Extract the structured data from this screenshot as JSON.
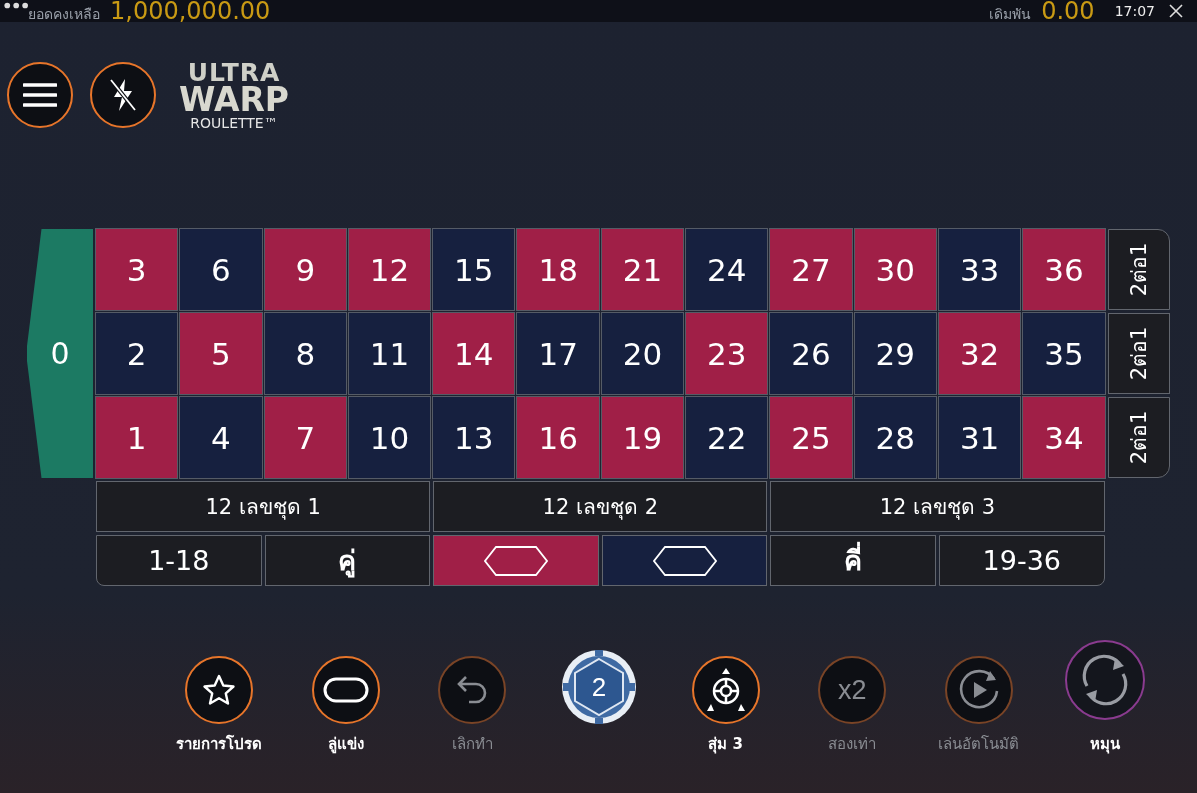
{
  "top_bar": {
    "balance_label": "ยอดคงเหลือ",
    "balance": "1,000,000.00",
    "bet_label": "เดิมพัน",
    "bet": "0.00",
    "time": "17:07"
  },
  "logo": {
    "line_1": "ULTRA",
    "line_2": "WARP",
    "line_3": "ROULETTE™"
  },
  "table": {
    "zero": "0",
    "rows": [
      {
        "cells": [
          {
            "number": "3",
            "color": "#a01f47"
          },
          {
            "number": "6",
            "color": "#16203f"
          },
          {
            "number": "9",
            "color": "#a01f47"
          },
          {
            "number": "12",
            "color": "#a01f47"
          },
          {
            "number": "15",
            "color": "#16203f"
          },
          {
            "number": "18",
            "color": "#a01f47"
          },
          {
            "number": "21",
            "color": "#a01f47"
          },
          {
            "number": "24",
            "color": "#16203f"
          },
          {
            "number": "27",
            "color": "#a01f47"
          },
          {
            "number": "30",
            "color": "#a01f47"
          },
          {
            "number": "33",
            "color": "#16203f"
          },
          {
            "number": "36",
            "color": "#a01f47"
          }
        ],
        "column_bet": "2ต่อ1"
      },
      {
        "cells": [
          {
            "number": "2",
            "color": "#16203f"
          },
          {
            "number": "5",
            "color": "#a01f47"
          },
          {
            "number": "8",
            "color": "#16203f"
          },
          {
            "number": "11",
            "color": "#16203f"
          },
          {
            "number": "14",
            "color": "#a01f47"
          },
          {
            "number": "17",
            "color": "#16203f"
          },
          {
            "number": "20",
            "color": "#16203f"
          },
          {
            "number": "23",
            "color": "#a01f47"
          },
          {
            "number": "26",
            "color": "#16203f"
          },
          {
            "number": "29",
            "color": "#16203f"
          },
          {
            "number": "32",
            "color": "#a01f47"
          },
          {
            "number": "35",
            "color": "#16203f"
          }
        ],
        "column_bet": "2ต่อ1"
      },
      {
        "cells": [
          {
            "number": "1",
            "color": "#a01f47"
          },
          {
            "number": "4",
            "color": "#16203f"
          },
          {
            "number": "7",
            "color": "#a01f47"
          },
          {
            "number": "10",
            "color": "#16203f"
          },
          {
            "number": "13",
            "color": "#16203f"
          },
          {
            "number": "16",
            "color": "#a01f47"
          },
          {
            "number": "19",
            "color": "#a01f47"
          },
          {
            "number": "22",
            "color": "#16203f"
          },
          {
            "number": "25",
            "color": "#a01f47"
          },
          {
            "number": "28",
            "color": "#16203f"
          },
          {
            "number": "31",
            "color": "#16203f"
          },
          {
            "number": "34",
            "color": "#a01f47"
          }
        ],
        "column_bet": "2ต่อ1"
      }
    ],
    "dozens": [
      "12 เลขชุด 1",
      "12 เลขชุด 2",
      "12 เลขชุด 3"
    ],
    "outside_bets": [
      {
        "kind": "text",
        "label": "1-18"
      },
      {
        "kind": "text",
        "label": "คู่"
      },
      {
        "kind": "color",
        "color": "#a01f47"
      },
      {
        "kind": "color",
        "color": "#16203f"
      },
      {
        "kind": "text",
        "label": "คี่"
      },
      {
        "kind": "text",
        "label": "19-36"
      }
    ]
  },
  "controls": [
    {
      "kind": "star",
      "label": "รายการโปรด",
      "disabled": false
    },
    {
      "kind": "race",
      "label": "ลู่แข่ง",
      "disabled": false
    },
    {
      "kind": "undo",
      "label": "เลิกทำ",
      "disabled": true
    },
    {
      "kind": "chip",
      "value": "2"
    },
    {
      "kind": "random",
      "label": "สุ่ม 3",
      "disabled": false
    },
    {
      "kind": "double",
      "text": "x2",
      "label": "สองเท่า",
      "disabled": true
    },
    {
      "kind": "autoplay",
      "label": "เล่นอัตโนมัติ",
      "disabled": true
    },
    {
      "kind": "spin",
      "label": "หมุน",
      "disabled": false
    }
  ]
}
